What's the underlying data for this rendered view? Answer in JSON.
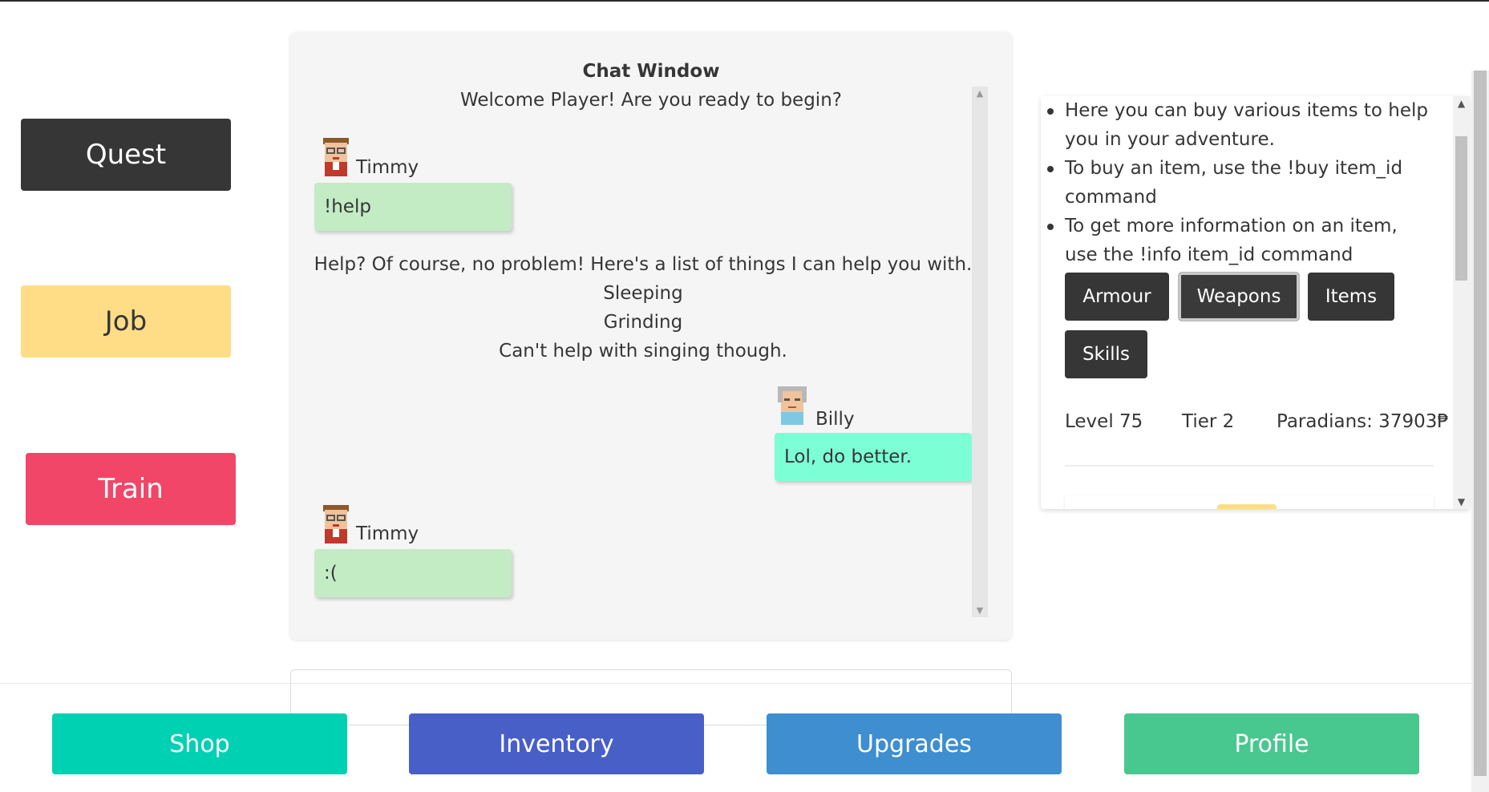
{
  "actions": {
    "quest_label": "Quest",
    "job_label": "Job",
    "train_label": "Train"
  },
  "chat": {
    "title": "Chat Window",
    "welcome": "Welcome Player! Are you ready to begin?",
    "messages": [
      {
        "sender": "Timmy",
        "text": "!help",
        "avatar": "timmy-avatar-icon"
      },
      {
        "sender": "Billy",
        "text": "Lol, do better.",
        "avatar": "billy-avatar-icon"
      },
      {
        "sender": "Timmy",
        "text": ":(",
        "avatar": "timmy-avatar-icon"
      }
    ],
    "bot_reply": [
      "Help? Of course, no problem! Here's a list of things I can help you with.",
      "Sleeping",
      "Grinding",
      "Can't help with singing though."
    ]
  },
  "shop": {
    "info": [
      "Here you can buy various items to help you in your adventure.",
      "To buy an item, use the !buy item_id command",
      "To get more information on an item, use the !info item_id command"
    ],
    "tabs": [
      "Armour",
      "Weapons",
      "Items",
      "Skills"
    ],
    "active_tab": "Weapons",
    "level": "Level 75",
    "tier": "Tier 2",
    "paradians": "Paradians: 37903₱"
  },
  "nav": {
    "shop_label": "Shop",
    "inventory_label": "Inventory",
    "upgrades_label": "Upgrades",
    "profile_label": "Profile"
  },
  "colors": {
    "quest": "#363636",
    "job": "#ffdd87",
    "train": "#f14668",
    "shop": "#00d1b2",
    "inventory": "#485fc7",
    "upgrades": "#3e8ed0",
    "profile": "#48c78e",
    "timmy_bubble": "#c3ecc5",
    "billy_bubble": "#7dffd6"
  }
}
